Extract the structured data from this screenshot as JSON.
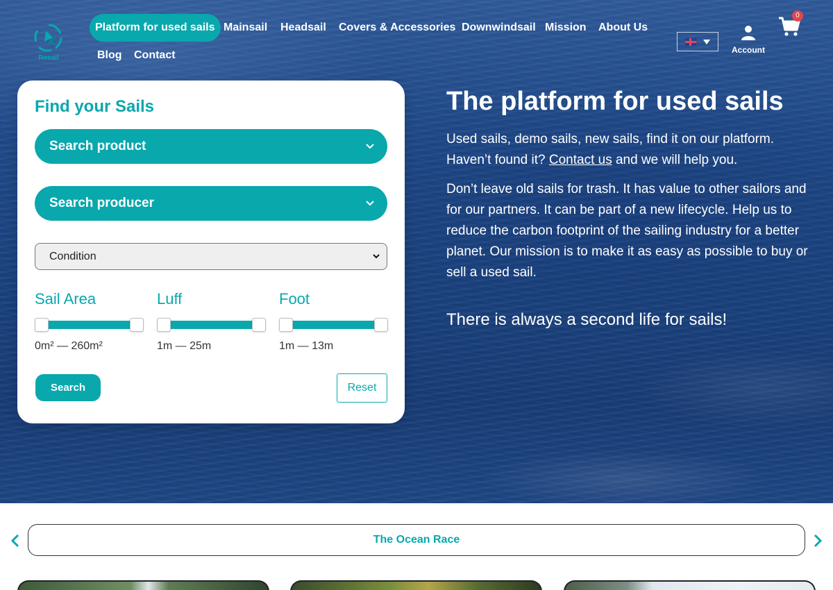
{
  "header": {
    "logo_text": "Resail",
    "nav": [
      {
        "label": "Platform for used sails",
        "active": true
      },
      {
        "label": "Mainsail"
      },
      {
        "label": "Headsail"
      },
      {
        "label": "Covers & Accessories"
      },
      {
        "label": "Downwindsail"
      },
      {
        "label": "Mission"
      },
      {
        "label": "About Us"
      },
      {
        "label": "Blog"
      },
      {
        "label": "Contact"
      }
    ],
    "language_icon": "uk-flag-icon",
    "account_label": "Account",
    "cart_count": "0"
  },
  "search_card": {
    "title": "Find your Sails",
    "product_select": "Search product",
    "producer_select": "Search producer",
    "condition_select": "Condition",
    "ranges": [
      {
        "label": "Sail Area",
        "value": "0m² — 260m²"
      },
      {
        "label": "Luff",
        "value": "1m — 25m"
      },
      {
        "label": "Foot",
        "value": "1m — 13m"
      }
    ],
    "search_button": "Search",
    "reset_button": "Reset"
  },
  "hero": {
    "title": "The platform for used sails",
    "p1_before": "Used sails, demo sails, new sails, find it on our platform. Haven’t found it?",
    "p1_link": "Contact us",
    "p1_after": "and we will help you.",
    "p2": "Don’t leave old sails for trash. It has value to other sailors and for our partners. It can be part of a new lifecycle. Help us to reduce the carbon footprint of the sailing industry for a better planet. Our mission is to make it as easy as possible to buy or sell a used sail.",
    "tagline": "There is always a second life for sails!"
  },
  "carousel": {
    "tab_label": "The Ocean Race"
  },
  "colors": {
    "accent": "#08a8ad",
    "ocean": "#1a427f",
    "badge": "#e0474c"
  }
}
